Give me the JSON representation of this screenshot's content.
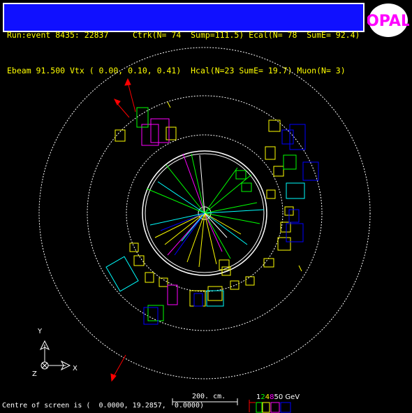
{
  "header": {
    "line1": "Run:event 8435: 22837     Ctrk(N= 74  Sump=111.5) Ecal(N= 78  SumE= 92.4)",
    "line2": "Ebeam 91.500 Vtx ( 0.00, 0.10, 0.41)  Hcal(N=23 SumE= 19.7) Muon(N= 3)"
  },
  "logo": {
    "text": "OPAL"
  },
  "footer": {
    "centre_text": "Centre of screen is (  0.0000, 19.2857,  0.0000)"
  },
  "scale": {
    "label": "200. cm."
  },
  "axes": {
    "x": "X",
    "y": "Y",
    "z": "Z"
  },
  "energy_legend": {
    "items": [
      {
        "text": "1",
        "color": "#ffffff"
      },
      {
        "text": "2",
        "color": "#00ff00"
      },
      {
        "text": "4",
        "color": "#ffff00"
      },
      {
        "text": "8",
        "color": "#ff00ff"
      },
      {
        "text": "50 GeV",
        "color": "#ffffff"
      }
    ]
  },
  "colors": {
    "header_bg": "#1010ff",
    "header_text": "#ffff00",
    "tracks": [
      "#00ff00",
      "#ffff00",
      "#ff00ff",
      "#0000ff",
      "#00ffff",
      "#ff0000"
    ]
  }
}
